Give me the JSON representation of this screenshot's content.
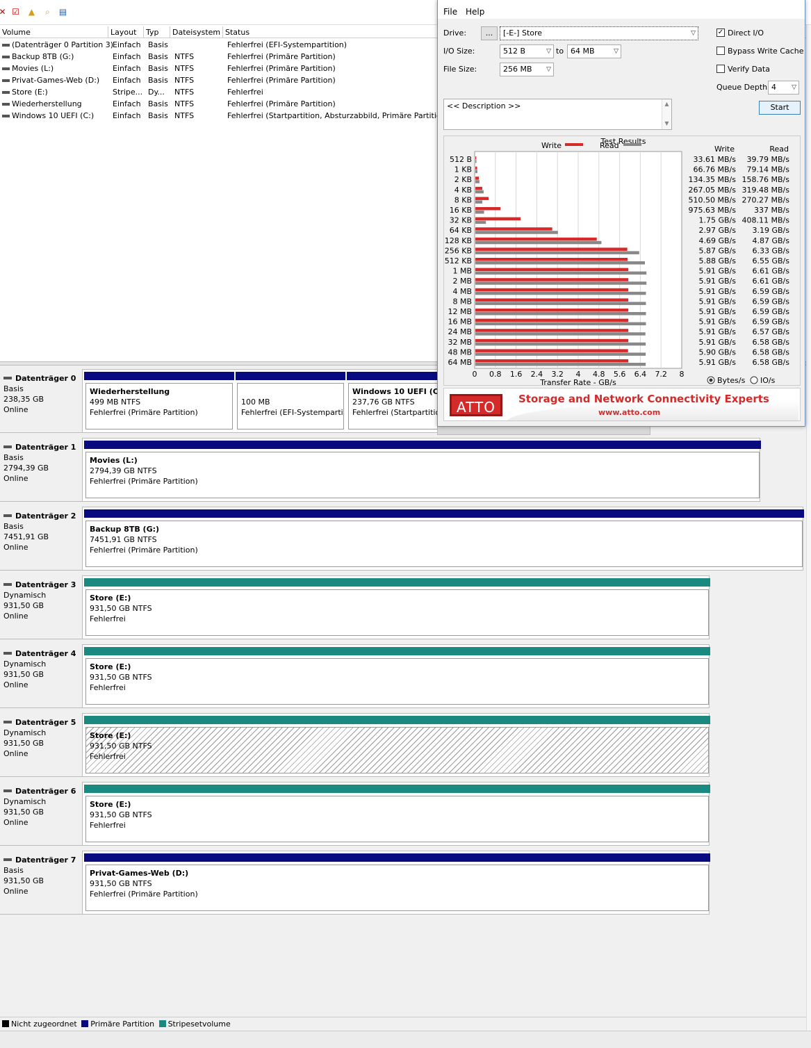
{
  "toolbar": {
    "icons": [
      "delete-icon",
      "check-icon",
      "up-folder-icon",
      "search-folder-icon",
      "properties-icon"
    ]
  },
  "volume_list": {
    "columns": [
      "Volume",
      "Layout",
      "Typ",
      "Dateisystem",
      "Status"
    ],
    "rows": [
      {
        "volume": "(Datenträger 0 Partition 3)",
        "layout": "Einfach",
        "typ": "Basis",
        "fs": "",
        "status": "Fehlerfrei (EFI-Systempartition)"
      },
      {
        "volume": "Backup 8TB (G:)",
        "layout": "Einfach",
        "typ": "Basis",
        "fs": "NTFS",
        "status": "Fehlerfrei (Primäre Partition)"
      },
      {
        "volume": "Movies (L:)",
        "layout": "Einfach",
        "typ": "Basis",
        "fs": "NTFS",
        "status": "Fehlerfrei (Primäre Partition)"
      },
      {
        "volume": "Privat-Games-Web (D:)",
        "layout": "Einfach",
        "typ": "Basis",
        "fs": "NTFS",
        "status": "Fehlerfrei (Primäre Partition)"
      },
      {
        "volume": "Store (E:)",
        "layout": "Stripe...",
        "typ": "Dy...",
        "fs": "NTFS",
        "status": "Fehlerfrei"
      },
      {
        "volume": "Wiederherstellung",
        "layout": "Einfach",
        "typ": "Basis",
        "fs": "NTFS",
        "status": "Fehlerfrei (Primäre Partition)"
      },
      {
        "volume": "Windows 10 UEFI (C:)",
        "layout": "Einfach",
        "typ": "Basis",
        "fs": "NTFS",
        "status": "Fehlerfrei (Startpartition, Absturzabbild, Primäre Partition)"
      }
    ]
  },
  "disks": [
    {
      "name": "Datenträger 0",
      "type": "Basis",
      "size": "238,35 GB",
      "state": "Online",
      "partitions": [
        {
          "name": "Wiederherstellung",
          "size": "499 MB NTFS",
          "status": "Fehlerfrei (Primäre Partition)",
          "kind": "primary"
        },
        {
          "name": "",
          "size": "100 MB",
          "status": "Fehlerfrei (EFI-Systempartiti",
          "kind": "primary"
        },
        {
          "name": "Windows 10 UEFI  (C:)",
          "size": "237,76 GB NTFS",
          "status": "Fehlerfrei (Startpartition",
          "kind": "primary"
        }
      ]
    },
    {
      "name": "Datenträger 1",
      "type": "Basis",
      "size": "2794,39 GB",
      "state": "Online",
      "partitions": [
        {
          "name": "Movies  (L:)",
          "size": "2794,39 GB NTFS",
          "status": "Fehlerfrei (Primäre Partition)",
          "kind": "primary"
        }
      ]
    },
    {
      "name": "Datenträger 2",
      "type": "Basis",
      "size": "7451,91 GB",
      "state": "Online",
      "partitions": [
        {
          "name": "Backup 8TB  (G:)",
          "size": "7451,91 GB NTFS",
          "status": "Fehlerfrei (Primäre Partition)",
          "kind": "primary"
        }
      ]
    },
    {
      "name": "Datenträger 3",
      "type": "Dynamisch",
      "size": "931,50 GB",
      "state": "Online",
      "partitions": [
        {
          "name": "Store  (E:)",
          "size": "931,50 GB NTFS",
          "status": "Fehlerfrei",
          "kind": "stripe"
        }
      ]
    },
    {
      "name": "Datenträger 4",
      "type": "Dynamisch",
      "size": "931,50 GB",
      "state": "Online",
      "partitions": [
        {
          "name": "Store  (E:)",
          "size": "931,50 GB NTFS",
          "status": "Fehlerfrei",
          "kind": "stripe"
        }
      ]
    },
    {
      "name": "Datenträger 5",
      "type": "Dynamisch",
      "size": "931,50 GB",
      "state": "Online",
      "partitions": [
        {
          "name": "Store  (E:)",
          "size": "931,50 GB NTFS",
          "status": "Fehlerfrei",
          "kind": "stripe",
          "selected": true
        }
      ]
    },
    {
      "name": "Datenträger 6",
      "type": "Dynamisch",
      "size": "931,50 GB",
      "state": "Online",
      "partitions": [
        {
          "name": "Store  (E:)",
          "size": "931,50 GB NTFS",
          "status": "Fehlerfrei",
          "kind": "stripe"
        }
      ]
    },
    {
      "name": "Datenträger 7",
      "type": "Basis",
      "size": "931,50 GB",
      "state": "Online",
      "partitions": [
        {
          "name": "Privat-Games-Web  (D:)",
          "size": "931,50 GB NTFS",
          "status": "Fehlerfrei (Primäre Partition)",
          "kind": "primary"
        }
      ]
    }
  ],
  "legend": {
    "unallocated": "Nicht zugeordnet",
    "primary": "Primäre Partition",
    "stripe": "Stripesetvolume"
  },
  "colors": {
    "primary": "#0a0a80",
    "stripe": "#1a8a80",
    "unallocated": "#000000",
    "write": "#d42a2a",
    "read": "#888888"
  },
  "atto": {
    "menu": {
      "file": "File",
      "help": "Help"
    },
    "drive_label": "Drive:",
    "browse_label": "...",
    "drive_value": "[-E-] Store",
    "io_size_label": "I/O Size:",
    "io_from": "512 B",
    "io_to_label": "to",
    "io_to": "64 MB",
    "file_size_label": "File Size:",
    "file_size": "256 MB",
    "direct_io_label": "Direct I/O",
    "direct_io": true,
    "bypass_label": "Bypass Write Cache",
    "bypass": false,
    "verify_label": "Verify Data",
    "verify": false,
    "queue_label": "Queue Depth:",
    "queue_value": "4",
    "start_label": "Start",
    "description": "<< Description >>",
    "results_title": "Test Results",
    "write_label": "Write",
    "read_label": "Read",
    "bytes_label": "Bytes/s",
    "ios_label": "IO/s",
    "units_selected": "Bytes/s",
    "banner_logo": "ATTO",
    "banner_tag": "Storage and Network Connectivity Experts",
    "banner_url": "www.atto.com"
  },
  "chart_data": {
    "type": "bar",
    "orientation": "horizontal",
    "title": "Test Results",
    "xlabel": "Transfer Rate - GB/s",
    "xlim": [
      0,
      8
    ],
    "xticks": [
      "0",
      "0.8",
      "1.6",
      "2.4",
      "3.2",
      "4",
      "4.8",
      "5.6",
      "6.4",
      "7.2",
      "8"
    ],
    "grid": true,
    "legend": "top",
    "categories": [
      "512 B",
      "1 KB",
      "2 KB",
      "4 KB",
      "8 KB",
      "16 KB",
      "32 KB",
      "64 KB",
      "128 KB",
      "256 KB",
      "512 KB",
      "1 MB",
      "2 MB",
      "4 MB",
      "8 MB",
      "12 MB",
      "16 MB",
      "24 MB",
      "32 MB",
      "48 MB",
      "64 MB"
    ],
    "series": [
      {
        "name": "Write",
        "values": [
          0.0336,
          0.0668,
          0.1344,
          0.267,
          0.5105,
          0.9756,
          1.75,
          2.97,
          4.69,
          5.87,
          5.88,
          5.91,
          5.91,
          5.91,
          5.91,
          5.91,
          5.91,
          5.91,
          5.91,
          5.9,
          5.91
        ],
        "labels": [
          "33.61 MB/s",
          "66.76 MB/s",
          "134.35 MB/s",
          "267.05 MB/s",
          "510.50 MB/s",
          "975.63 MB/s",
          "1.75 GB/s",
          "2.97 GB/s",
          "4.69 GB/s",
          "5.87 GB/s",
          "5.88 GB/s",
          "5.91 GB/s",
          "5.91 GB/s",
          "5.91 GB/s",
          "5.91 GB/s",
          "5.91 GB/s",
          "5.91 GB/s",
          "5.91 GB/s",
          "5.91 GB/s",
          "5.90 GB/s",
          "5.91 GB/s"
        ]
      },
      {
        "name": "Read",
        "values": [
          0.0398,
          0.0791,
          0.1588,
          0.3195,
          0.2703,
          0.337,
          0.4081,
          3.19,
          4.87,
          6.33,
          6.55,
          6.61,
          6.61,
          6.59,
          6.59,
          6.59,
          6.59,
          6.57,
          6.58,
          6.58,
          6.58
        ],
        "labels": [
          "39.79 MB/s",
          "79.14 MB/s",
          "158.76 MB/s",
          "319.48 MB/s",
          "270.27 MB/s",
          "337 MB/s",
          "408.11 MB/s",
          "3.19 GB/s",
          "4.87 GB/s",
          "6.33 GB/s",
          "6.55 GB/s",
          "6.61 GB/s",
          "6.61 GB/s",
          "6.59 GB/s",
          "6.59 GB/s",
          "6.59 GB/s",
          "6.59 GB/s",
          "6.57 GB/s",
          "6.58 GB/s",
          "6.58 GB/s",
          "6.58 GB/s"
        ]
      }
    ]
  }
}
